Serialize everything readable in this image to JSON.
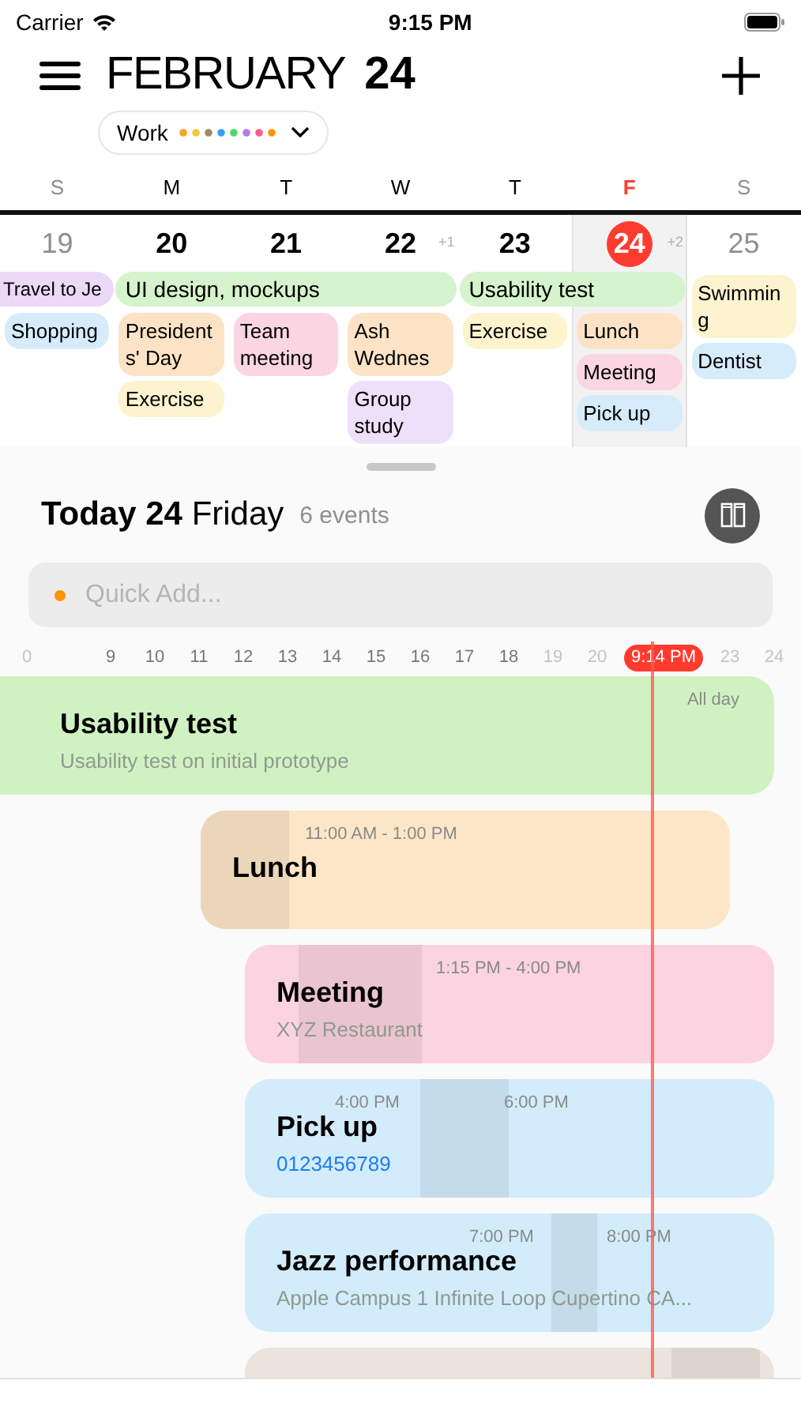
{
  "status_bar": {
    "carrier": "Carrier",
    "time": "9:15 PM"
  },
  "header": {
    "month": "FEBRUARY",
    "day": "24"
  },
  "calendar_filter": {
    "label": "Work",
    "dots": [
      {
        "color": "#f5a623"
      },
      {
        "color": "#f0c93a"
      },
      {
        "color": "#a08a6a"
      },
      {
        "color": "#3aa0f0"
      },
      {
        "color": "#4cd964"
      },
      {
        "color": "#b07ee8"
      },
      {
        "color": "#ff5a8c"
      },
      {
        "color": "#ff9500"
      }
    ]
  },
  "week": {
    "days": [
      {
        "letter": "S",
        "number": "19",
        "weekend": true,
        "selected": false,
        "bar": {
          "title": "Travel to Je",
          "color": "#ebd9f7"
        },
        "events": [
          {
            "title": "Shopping",
            "color": "#d6ecfb"
          }
        ]
      },
      {
        "letter": "M",
        "number": "20",
        "weekend": false,
        "selected": false,
        "bar": {
          "title": "UI design, mockups",
          "color": "#d5f3cc"
        },
        "events": [
          {
            "title": "Presidents' Day",
            "color": "#fde3c6"
          },
          {
            "title": "Exercise",
            "color": "#fdf3cf"
          }
        ]
      },
      {
        "letter": "T",
        "number": "21",
        "weekend": false,
        "selected": false,
        "bar_continues": true,
        "events": [
          {
            "title": "Team meeting",
            "color": "#fbd5e2"
          }
        ]
      },
      {
        "letter": "W",
        "number": "22",
        "weekend": false,
        "selected": false,
        "more": "+1",
        "bar_continues": true,
        "events": [
          {
            "title": "Ash Wednes",
            "color": "#fde3c6"
          },
          {
            "title": "Group study",
            "color": "#efe0fa"
          }
        ]
      },
      {
        "letter": "T",
        "number": "23",
        "weekend": false,
        "selected": false,
        "bar": {
          "title": "Usability test",
          "color": "#d5f3cc"
        },
        "events": [
          {
            "title": "Exercise",
            "color": "#fdf3cf"
          }
        ]
      },
      {
        "letter": "F",
        "number": "24",
        "weekend": false,
        "selected": true,
        "more": "+2",
        "bar_continues": true,
        "events": [
          {
            "title": "Lunch",
            "color": "#fde3c6"
          },
          {
            "title": "Meeting",
            "color": "#fbd5e2"
          },
          {
            "title": "Pick up",
            "color": "#d6ecfb"
          }
        ]
      },
      {
        "letter": "S",
        "number": "25",
        "weekend": true,
        "selected": false,
        "events": [
          {
            "title": "Swimming",
            "color": "#fdf3cf"
          },
          {
            "title": "Dentist",
            "color": "#d6ecfb"
          }
        ]
      }
    ]
  },
  "day_panel": {
    "title": "**Today 24** Friday",
    "count": "6 events",
    "quick_add": {
      "placeholder": "Quick Add..."
    },
    "hours": [
      {
        "kind": "hour",
        "label": "0",
        "dim": true
      },
      {
        "kind": "hour",
        "label": "9",
        "dim": false
      },
      {
        "kind": "hour",
        "label": "10",
        "dim": false
      },
      {
        "kind": "hour",
        "label": "11",
        "dim": false
      },
      {
        "kind": "hour",
        "label": "12",
        "dim": false
      },
      {
        "kind": "hour",
        "label": "13",
        "dim": false
      },
      {
        "kind": "hour",
        "label": "14",
        "dim": false
      },
      {
        "kind": "hour",
        "label": "15",
        "dim": false
      },
      {
        "kind": "hour",
        "label": "16",
        "dim": false
      },
      {
        "kind": "hour",
        "label": "17",
        "dim": false
      },
      {
        "kind": "hour",
        "label": "18",
        "dim": false
      },
      {
        "kind": "hour",
        "label": "19",
        "dim": true
      },
      {
        "kind": "hour",
        "label": "20",
        "dim": true
      },
      {
        "kind": "now",
        "label": "9:14 PM"
      },
      {
        "kind": "hour",
        "label": "23",
        "dim": true
      },
      {
        "kind": "hour",
        "label": "24",
        "dim": true
      }
    ],
    "events": [
      {
        "title": "Usability test",
        "times": [
          "All day"
        ],
        "subtitle": {
          "kind": "note",
          "text": "Usability test on initial prototype"
        },
        "color": "#d0f2c2"
      },
      {
        "title": "Lunch",
        "times": [
          "11:00 AM - 1:00 PM"
        ],
        "color": "#fde6c8"
      },
      {
        "title": "Meeting",
        "times": [
          "1:15 PM - 4:00 PM"
        ],
        "subtitle": {
          "kind": "note",
          "text": "XYZ Restaurant"
        },
        "color": "#fcd3e0"
      },
      {
        "title": "Pick up",
        "times": [
          "4:00 PM",
          "6:00 PM"
        ],
        "subtitle": {
          "kind": "phone",
          "text": "0123456789"
        },
        "color": "#d3ecfb"
      },
      {
        "title": "Jazz performance",
        "times": [
          "7:00 PM",
          "8:00 PM"
        ],
        "subtitle": {
          "kind": "note",
          "text": "Apple Campus 1 Infinite Loop Cupertino CA..."
        },
        "color": "#d3ecfb"
      },
      {
        "color": "#ece4dc"
      }
    ]
  }
}
